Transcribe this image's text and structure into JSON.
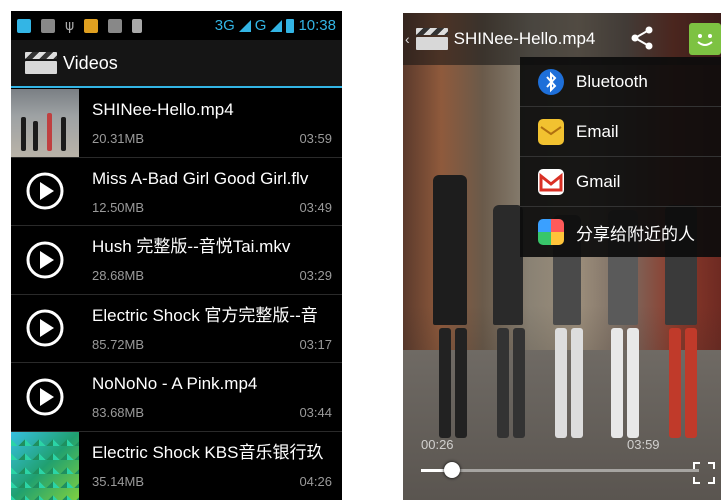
{
  "left": {
    "status": {
      "network": "3G",
      "network2": "G",
      "time": "10:38"
    },
    "app_title": "Videos",
    "videos": [
      {
        "title": "SHINee-Hello.mp4",
        "size": "20.31MB",
        "duration": "03:59",
        "thumb": "dancers"
      },
      {
        "title": "Miss A-Bad Girl Good Girl.flv",
        "size": "12.50MB",
        "duration": "03:49",
        "thumb": "play-icon"
      },
      {
        "title": "Hush 完整版--音悦Tai.mkv",
        "size": "28.68MB",
        "duration": "03:29",
        "thumb": "play-icon"
      },
      {
        "title": "Electric Shock 官方完整版--音",
        "size": "85.72MB",
        "duration": "03:17",
        "thumb": "play-icon"
      },
      {
        "title": "NoNoNo - A Pink.mp4",
        "size": "83.68MB",
        "duration": "03:44",
        "thumb": "play-icon"
      },
      {
        "title": "Electric Shock KBS音乐银行玖",
        "size": "35.14MB",
        "duration": "04:26",
        "thumb": "colorful"
      }
    ]
  },
  "right": {
    "video_title": "SHINee-Hello.mp4",
    "share_menu": [
      {
        "label": "Bluetooth",
        "icon": "bluetooth-icon"
      },
      {
        "label": "Email",
        "icon": "email-icon"
      },
      {
        "label": "Gmail",
        "icon": "gmail-icon"
      },
      {
        "label": "分享给附近的人",
        "icon": "nearby-share-icon"
      }
    ],
    "elapsed": "00:26",
    "total": "03:59",
    "progress": 0.11
  },
  "colors": {
    "accent": "#33b5e5",
    "gmail_red": "#d93025",
    "bt_blue": "#1e6fd9",
    "menu_bg": "#0c0c0c"
  }
}
